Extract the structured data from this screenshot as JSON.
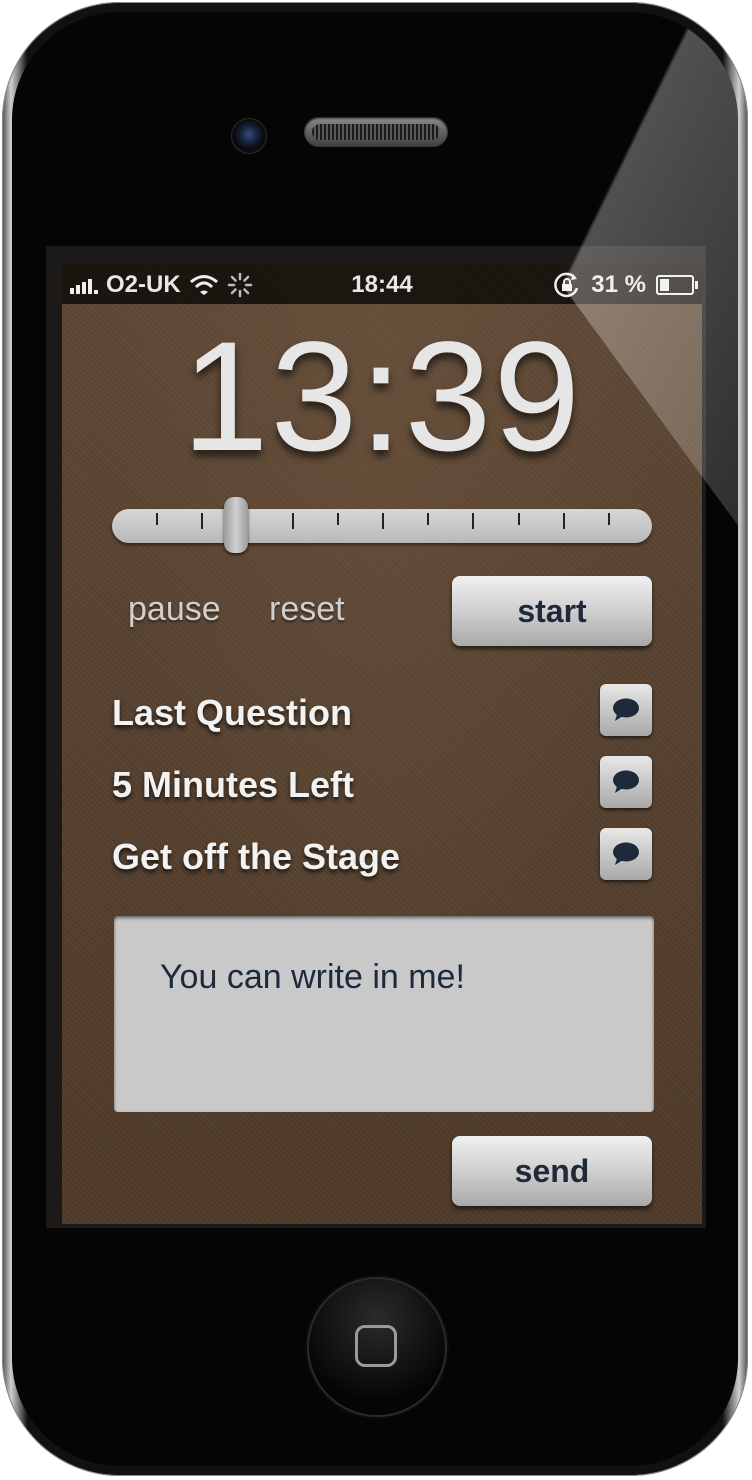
{
  "status_bar": {
    "carrier": "O2-UK",
    "time": "18:44",
    "battery_percent": "31 %",
    "battery_level": 0.31,
    "icons": [
      "signal-bars-icon",
      "wifi-icon",
      "activity-spinner-icon",
      "rotation-lock-icon",
      "battery-icon"
    ]
  },
  "timer": {
    "display": "13:39",
    "slider_position": 0.23
  },
  "controls": {
    "pause_label": "pause",
    "reset_label": "reset",
    "start_label": "start"
  },
  "messages": [
    {
      "label": "Last Question"
    },
    {
      "label": "5 Minutes Left"
    },
    {
      "label": "Get off the Stage"
    }
  ],
  "compose": {
    "value": "You can write in me!",
    "send_label": "send"
  },
  "colors": {
    "background": "#5b4532",
    "button_text": "#1e2a3a",
    "text_light": "#f2f2f2"
  }
}
